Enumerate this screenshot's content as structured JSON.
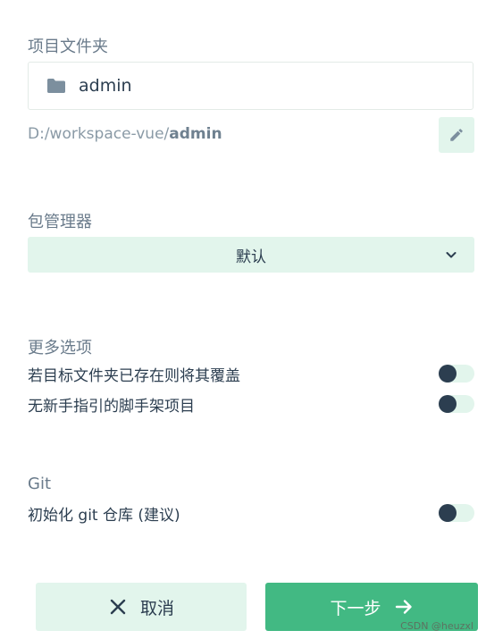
{
  "sections": {
    "project_folder": {
      "heading": "项目文件夹",
      "folder_name": "admin",
      "path_prefix": "D:/workspace-vue/",
      "path_name": "admin",
      "icons": {
        "folder": "folder-icon",
        "edit": "pencil-icon"
      }
    },
    "package_manager": {
      "heading": "包管理器",
      "selected": "默认",
      "icon": "chevron-down-icon"
    },
    "more_options": {
      "heading": "更多选项",
      "options": [
        {
          "label": "若目标文件夹已存在则将其覆盖",
          "enabled": false
        },
        {
          "label": "无新手指引的脚手架项目",
          "enabled": false
        }
      ]
    },
    "git": {
      "heading": "Git",
      "option": {
        "label": "初始化 git 仓库 (建议)",
        "enabled": false
      }
    }
  },
  "buttons": {
    "cancel": {
      "label": "取消",
      "icon": "close-icon"
    },
    "next": {
      "label": "下一步",
      "icon": "arrow-right-icon"
    }
  },
  "watermark": "CSDN @heuzxl",
  "colors": {
    "accent": "#42b983",
    "accent_light": "#e2f5ec",
    "text": "#2c3e50",
    "muted": "#6a7b8b"
  }
}
